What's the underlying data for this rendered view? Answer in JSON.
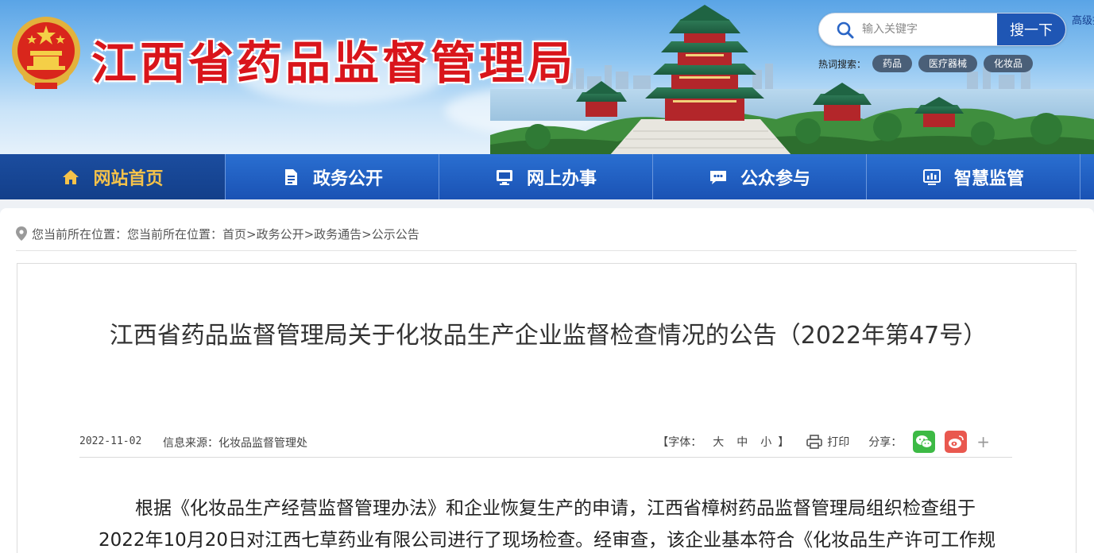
{
  "header": {
    "site_title": "江西省药品监督管理局",
    "search_placeholder": "输入关键字",
    "search_button": "搜一下",
    "advanced_search": "高级搜索",
    "hot_label": "热词搜索：",
    "hot_tags": [
      "药品",
      "医疗器械",
      "化妆品"
    ]
  },
  "nav": {
    "items": [
      {
        "label": "网站首页",
        "icon": "home-icon"
      },
      {
        "label": "政务公开",
        "icon": "document-icon"
      },
      {
        "label": "网上办事",
        "icon": "monitor-icon"
      },
      {
        "label": "公众参与",
        "icon": "chat-icon"
      },
      {
        "label": "智慧监管",
        "icon": "dashboard-icon"
      }
    ]
  },
  "breadcrumb": {
    "text": "您当前所在位置：您当前所在位置：首页>政务公开>政务通告>公示公告"
  },
  "article": {
    "title": "江西省药品监督管理局关于化妆品生产企业监督检查情况的公告（2022年第47号）",
    "date": "2022-11-02",
    "source": "信息来源：化妆品监督管理处",
    "font_label": "【字体：",
    "font_large": "大",
    "font_medium": "中",
    "font_small": "小",
    "font_close": "】",
    "print_label": "打印",
    "share_label": "分享：",
    "share_more": "+",
    "paragraph": "根据《化妆品生产经营监督管理办法》和企业恢复生产的申请，江西省樟树药品监督管理局组织检查组于2022年10月20日对江西七草药业有限公司进行了现场检查。经审查，该企业基本符合《化妆品生产许可工作规"
  },
  "colors": {
    "title_red": "#d9151b",
    "nav_blue": "#1a52b4",
    "nav_active_text": "#f5c24a"
  }
}
